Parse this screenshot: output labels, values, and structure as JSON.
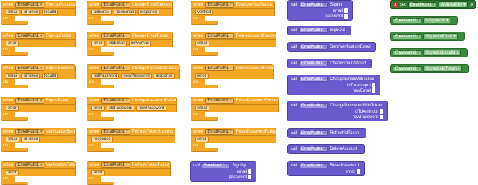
{
  "labels": {
    "when": "when",
    "do": "do",
    "call": "call",
    "set": "set",
    "to": "to",
    "component": "EmailAuth1",
    "error_icon": "x"
  },
  "events": [
    {
      "name": "SignUpSuccess",
      "params": [
        "email",
        "idToken",
        "localId"
      ]
    },
    {
      "name": "SignUpFailed",
      "params": [
        "error"
      ]
    },
    {
      "name": "SignInSuccess",
      "params": [
        "email",
        "idToken",
        "localId"
      ]
    },
    {
      "name": "SignInFailed",
      "params": [
        "error"
      ]
    },
    {
      "name": "VerificationSent",
      "params": [
        "email",
        "idToken"
      ]
    },
    {
      "name": "VerificationFailed",
      "params": [
        "error"
      ]
    },
    {
      "name": "ChangeEmailSuccess",
      "params": [
        "oldEmail",
        "newEmail",
        "response"
      ]
    },
    {
      "name": "ChangeEmailFailed",
      "params": [
        "error",
        "oldEmail",
        "newEmail"
      ]
    },
    {
      "name": "ChangePasswordSuccess",
      "params": [
        "oldPassword",
        "newPassword",
        "response"
      ]
    },
    {
      "name": "ChangePasswordFailed",
      "params": [
        "error",
        "oldPassword",
        "newPassword"
      ]
    },
    {
      "name": "RefreshTokenSuccess",
      "params": [
        "response"
      ]
    },
    {
      "name": "RefreshTokenFailed",
      "params": [
        "error"
      ]
    },
    {
      "name": "EmailVerifiedStatus",
      "params": [
        "verified"
      ]
    },
    {
      "name": "DeleteAccountSuccess",
      "params": [
        "email"
      ]
    },
    {
      "name": "DeleteAccountFailed",
      "params": [
        "error"
      ]
    },
    {
      "name": "ResetPasswordSuccess",
      "params": [
        "email"
      ]
    },
    {
      "name": "ResetPasswordFailed",
      "params": [
        "error"
      ]
    }
  ],
  "methods": [
    {
      "name": "SignUp",
      "args": [
        "email",
        "password"
      ]
    },
    {
      "name": "SignIn",
      "args": [
        "email",
        "password"
      ]
    },
    {
      "name": "SignOut",
      "args": []
    },
    {
      "name": "SendVerificationEmail",
      "args": []
    },
    {
      "name": "CheckEmailVerified",
      "args": []
    },
    {
      "name": "ChangeEmailWithToken",
      "args": [
        "idTokenInput",
        "newEmail"
      ]
    },
    {
      "name": "ChangePasswordWithToken",
      "args": [
        "idTokenInput",
        "newPassword"
      ]
    },
    {
      "name": "RefreshIdToken",
      "args": []
    },
    {
      "name": "DeleteAccount",
      "args": []
    },
    {
      "name": "ResetPassword",
      "args": [
        "email"
      ]
    }
  ],
  "setter": {
    "property": "WebApiKey"
  },
  "getters": [
    "IsSignedIn",
    "SignedInEmail",
    "SignedInLocalId",
    "SignedInIdToken"
  ]
}
